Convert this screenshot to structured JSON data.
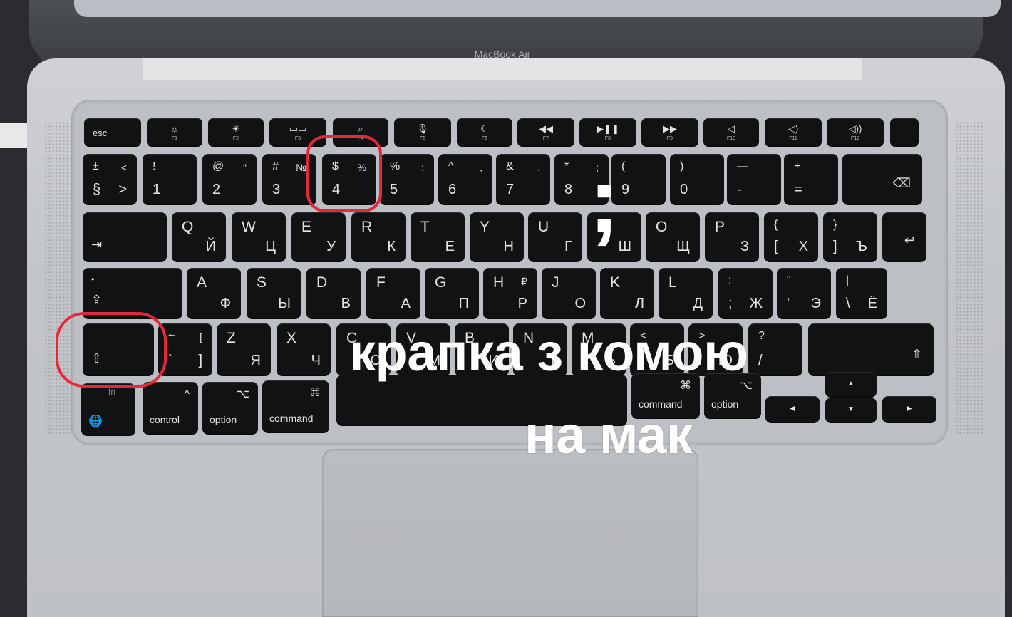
{
  "laptop": {
    "brand_label": "MacBook Air"
  },
  "overlay": {
    "symbol": ";",
    "headline_line1": "крапка з комою",
    "headline_line2": "на мак"
  },
  "highlight_color": "#e4283c",
  "keyboard": {
    "function_row": [
      {
        "id": "esc",
        "label": "esc"
      },
      {
        "id": "f1",
        "icon": "☼",
        "sub": "F1"
      },
      {
        "id": "f2",
        "icon": "☀",
        "sub": "F2"
      },
      {
        "id": "f3",
        "icon": "▭▭",
        "sub": "F3"
      },
      {
        "id": "f4",
        "icon": "⌕",
        "sub": "F4"
      },
      {
        "id": "f5",
        "icon": "🎙",
        "sub": "F5"
      },
      {
        "id": "f6",
        "icon": "☾",
        "sub": "F6"
      },
      {
        "id": "f7",
        "icon": "◀◀",
        "sub": "F7"
      },
      {
        "id": "f8",
        "icon": "▶❚❚",
        "sub": "F8"
      },
      {
        "id": "f9",
        "icon": "▶▶",
        "sub": "F9"
      },
      {
        "id": "f10",
        "icon": "◁",
        "sub": "F10"
      },
      {
        "id": "f11",
        "icon": "◁)",
        "sub": "F11"
      },
      {
        "id": "f12",
        "icon": "◁))",
        "sub": "F12"
      },
      {
        "id": "touchid",
        "label": ""
      }
    ],
    "number_row": [
      {
        "id": "section",
        "tl": "±",
        "bl": "§",
        "tr": "<",
        "br": ">"
      },
      {
        "id": "1",
        "tl": "!",
        "bl": "1",
        "tr": "",
        "br": ""
      },
      {
        "id": "2",
        "tl": "@",
        "bl": "2",
        "tr": "\"",
        "br": ""
      },
      {
        "id": "3",
        "tl": "#",
        "bl": "3",
        "tr": "№",
        "br": ""
      },
      {
        "id": "4",
        "tl": "$",
        "bl": "4",
        "tr": "%",
        "br": ""
      },
      {
        "id": "5",
        "tl": "%",
        "bl": "5",
        "tr": ":",
        "br": ""
      },
      {
        "id": "6",
        "tl": "^",
        "bl": "6",
        "tr": ",",
        "br": ""
      },
      {
        "id": "7",
        "tl": "&",
        "bl": "7",
        "tr": ".",
        "br": ""
      },
      {
        "id": "8",
        "tl": "*",
        "bl": "8",
        "tr": ";",
        "br": ""
      },
      {
        "id": "9",
        "tl": "(",
        "bl": "9",
        "tr": "",
        "br": ""
      },
      {
        "id": "0",
        "tl": ")",
        "bl": "0",
        "tr": "",
        "br": ""
      },
      {
        "id": "minus",
        "tl": "—",
        "bl": "-",
        "tr": "",
        "br": ""
      },
      {
        "id": "equal",
        "tl": "+",
        "bl": "=",
        "tr": "",
        "br": ""
      },
      {
        "id": "delete",
        "icon": "⌫"
      }
    ],
    "top_row": [
      {
        "id": "tab",
        "icon": "⇥"
      },
      {
        "id": "q",
        "tl": "Q",
        "br": "Й"
      },
      {
        "id": "w",
        "tl": "W",
        "br": "Ц"
      },
      {
        "id": "e",
        "tl": "E",
        "br": "У"
      },
      {
        "id": "r",
        "tl": "R",
        "br": "К"
      },
      {
        "id": "t",
        "tl": "T",
        "br": "Е"
      },
      {
        "id": "y",
        "tl": "Y",
        "br": "Н"
      },
      {
        "id": "u",
        "tl": "U",
        "br": "Г"
      },
      {
        "id": "i",
        "tl": "I",
        "br": "Ш"
      },
      {
        "id": "o",
        "tl": "O",
        "br": "Щ"
      },
      {
        "id": "p",
        "tl": "P",
        "br": "З"
      },
      {
        "id": "lbrace",
        "tl": "{",
        "bl": "[",
        "br": "Х"
      },
      {
        "id": "rbrace",
        "tl": "}",
        "bl": "]",
        "br": "Ъ"
      },
      {
        "id": "return",
        "icon": "↩"
      }
    ],
    "home_row": [
      {
        "id": "caps",
        "tl": "•",
        "icon": "⇪"
      },
      {
        "id": "a",
        "tl": "A",
        "br": "Ф"
      },
      {
        "id": "s",
        "tl": "S",
        "br": "Ы"
      },
      {
        "id": "d",
        "tl": "D",
        "br": "В"
      },
      {
        "id": "f",
        "tl": "F",
        "br": "А"
      },
      {
        "id": "g",
        "tl": "G",
        "br": "П"
      },
      {
        "id": "h",
        "tl": "H",
        "tr": "₽",
        "br": "Р"
      },
      {
        "id": "j",
        "tl": "J",
        "br": "О"
      },
      {
        "id": "k",
        "tl": "K",
        "br": "Л"
      },
      {
        "id": "l",
        "tl": "L",
        "br": "Д"
      },
      {
        "id": "semicolon",
        "tl": ":",
        "bl": ";",
        "br": "Ж"
      },
      {
        "id": "quote",
        "tl": "\"",
        "bl": "'",
        "br": "Э"
      },
      {
        "id": "backslash",
        "tl": "|",
        "bl": "\\",
        "br": "Ё"
      }
    ],
    "bottom_row": [
      {
        "id": "lshift",
        "icon": "⇧"
      },
      {
        "id": "grave",
        "tl": "~",
        "bl": "`",
        "tr": "[",
        "br": "]"
      },
      {
        "id": "z",
        "tl": "Z",
        "br": "Я"
      },
      {
        "id": "x",
        "tl": "X",
        "br": "Ч"
      },
      {
        "id": "c",
        "tl": "C",
        "br": "С"
      },
      {
        "id": "v",
        "tl": "V",
        "br": "М"
      },
      {
        "id": "b",
        "tl": "B",
        "br": "И"
      },
      {
        "id": "n",
        "tl": "N",
        "br": "Т"
      },
      {
        "id": "m",
        "tl": "M",
        "br": "Ь"
      },
      {
        "id": "comma",
        "tl": "<",
        "bl": ",",
        "br": "Б"
      },
      {
        "id": "period",
        "tl": ">",
        "bl": ".",
        "br": "Ю"
      },
      {
        "id": "slash",
        "tl": "?",
        "bl": "/",
        "br": ""
      },
      {
        "id": "rshift",
        "icon": "⇧"
      }
    ],
    "modifier_row": [
      {
        "id": "fn",
        "tl": "fn",
        "icon": "🌐"
      },
      {
        "id": "control",
        "icon": "^",
        "label": "control"
      },
      {
        "id": "option",
        "icon": "⌥",
        "label": "option"
      },
      {
        "id": "command",
        "icon": "⌘",
        "label": "command"
      },
      {
        "id": "space",
        "label": ""
      },
      {
        "id": "rcommand",
        "icon": "⌘",
        "label": "command"
      },
      {
        "id": "roption",
        "icon": "⌥",
        "label": "option"
      },
      {
        "id": "left",
        "icon": "◀"
      },
      {
        "id": "up",
        "icon": "▲"
      },
      {
        "id": "down",
        "icon": "▼"
      },
      {
        "id": "right",
        "icon": "▶"
      }
    ]
  }
}
